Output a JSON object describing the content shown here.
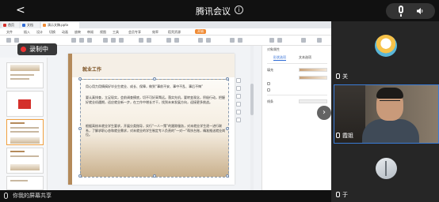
{
  "meeting": {
    "title": "腾讯会议",
    "info_glyph": "i",
    "back_glyph": "<"
  },
  "recording": {
    "label": "录制中"
  },
  "share": {
    "label": "你我的屏幕共享"
  },
  "app": {
    "tabs": [
      {
        "label": "首页",
        "color": "#d4302b"
      },
      {
        "label": "文档",
        "color": "#2e6bd6"
      },
      {
        "label": "演示文稿.pptx",
        "color": "#f08c36"
      }
    ],
    "menu": [
      "文件",
      "开始",
      "插入",
      "设计",
      "切换",
      "动画",
      "放映",
      "审阅",
      "视图",
      "工具",
      "会员专享",
      "效率",
      "稻壳资源"
    ],
    "menu_start": "开始"
  },
  "slide": {
    "title": "就业工作",
    "bullets": [
      "用心用力用情搞好毕业生就业、成长、保障，做到“事前不安、事中不乱、事后不悔”",
      "要认真排查，立足现实，会前调查摸底，切不可好高骛远。落实先机，要转变观念，积极行动，把握好就业机遇期，适应就业新一步，在工作中增长才干，找到未来发展方向，迎接更多挑战。",
      "根据高校本就业学生要求，开展分类指导，实行“一人一策”的跟踪服务，对未就业学生逐一进行联系，了解求职心态和就业需求，对未就业的学生制定专人负责的“一对一”帮扶台账，精准推送就业岗位。"
    ]
  },
  "props_panel": {
    "title": "对象属性",
    "tabs": [
      "形状选项",
      "文本选项"
    ],
    "rows": [
      "填充",
      "线条"
    ]
  },
  "participants": [
    {
      "name": "关"
    },
    {
      "name": "霞姐"
    },
    {
      "name": "于"
    }
  ],
  "colors": {
    "recording_dot": "#e33333",
    "slide_accent": "#b48a5a",
    "active_speaker": "#3a7bd5"
  },
  "icons": {
    "back": "chevron-left-icon",
    "info": "info-icon",
    "mic": "microphone-icon",
    "speaker": "speaker-icon",
    "record": "record-dot-icon",
    "collapse": "chevron-right-icon"
  }
}
